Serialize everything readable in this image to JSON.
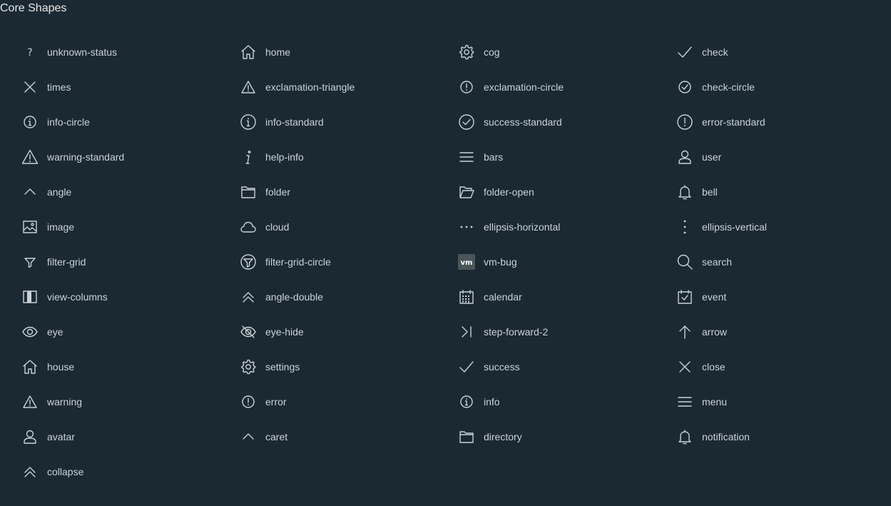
{
  "title": "Core Shapes",
  "icons": [
    {
      "label": "unknown-status",
      "icon": "unknown-status"
    },
    {
      "label": "home",
      "icon": "home"
    },
    {
      "label": "cog",
      "icon": "cog"
    },
    {
      "label": "check",
      "icon": "check"
    },
    {
      "label": "times",
      "icon": "times"
    },
    {
      "label": "exclamation-triangle",
      "icon": "exclamation-triangle"
    },
    {
      "label": "exclamation-circle",
      "icon": "exclamation-circle"
    },
    {
      "label": "check-circle",
      "icon": "check-circle"
    },
    {
      "label": "info-circle",
      "icon": "info-circle"
    },
    {
      "label": "info-standard",
      "icon": "info-standard"
    },
    {
      "label": "success-standard",
      "icon": "success-standard"
    },
    {
      "label": "error-standard",
      "icon": "error-standard"
    },
    {
      "label": "warning-standard",
      "icon": "warning-standard"
    },
    {
      "label": "help-info",
      "icon": "help-info"
    },
    {
      "label": "bars",
      "icon": "bars"
    },
    {
      "label": "user",
      "icon": "user"
    },
    {
      "label": "angle",
      "icon": "angle"
    },
    {
      "label": "folder",
      "icon": "folder"
    },
    {
      "label": "folder-open",
      "icon": "folder-open"
    },
    {
      "label": "bell",
      "icon": "bell"
    },
    {
      "label": "image",
      "icon": "image"
    },
    {
      "label": "cloud",
      "icon": "cloud"
    },
    {
      "label": "ellipsis-horizontal",
      "icon": "ellipsis-horizontal"
    },
    {
      "label": "ellipsis-vertical",
      "icon": "ellipsis-vertical"
    },
    {
      "label": "filter-grid",
      "icon": "filter-grid"
    },
    {
      "label": "filter-grid-circle",
      "icon": "filter-grid-circle"
    },
    {
      "label": "vm-bug",
      "icon": "vm-bug",
      "icon_text": "vm"
    },
    {
      "label": "search",
      "icon": "search"
    },
    {
      "label": "view-columns",
      "icon": "view-columns"
    },
    {
      "label": "angle-double",
      "icon": "angle-double"
    },
    {
      "label": "calendar",
      "icon": "calendar"
    },
    {
      "label": "event",
      "icon": "event"
    },
    {
      "label": "eye",
      "icon": "eye"
    },
    {
      "label": "eye-hide",
      "icon": "eye-hide"
    },
    {
      "label": "step-forward-2",
      "icon": "step-forward-2"
    },
    {
      "label": "arrow",
      "icon": "arrow"
    },
    {
      "label": "house",
      "icon": "home"
    },
    {
      "label": "settings",
      "icon": "cog"
    },
    {
      "label": "success",
      "icon": "check"
    },
    {
      "label": "close",
      "icon": "times"
    },
    {
      "label": "warning",
      "icon": "exclamation-triangle"
    },
    {
      "label": "error",
      "icon": "exclamation-circle"
    },
    {
      "label": "info",
      "icon": "info-circle"
    },
    {
      "label": "menu",
      "icon": "bars"
    },
    {
      "label": "avatar",
      "icon": "user"
    },
    {
      "label": "caret",
      "icon": "angle"
    },
    {
      "label": "directory",
      "icon": "folder"
    },
    {
      "label": "notification",
      "icon": "bell"
    },
    {
      "label": "collapse",
      "icon": "angle-double"
    }
  ],
  "colors": {
    "background": "#1b2a32",
    "icon": "#c9d1d6",
    "text": "#c9d1d6",
    "vm_bg": "#4a5559"
  }
}
